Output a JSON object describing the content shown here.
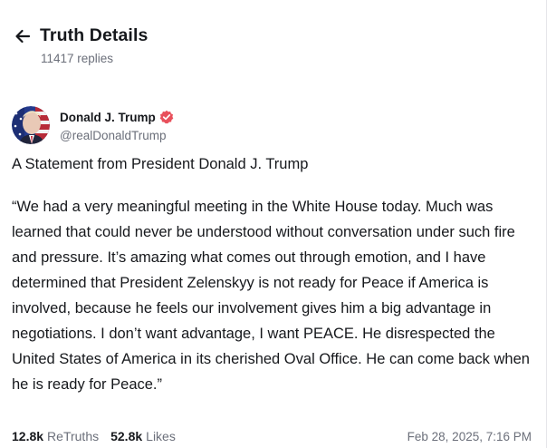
{
  "header": {
    "back_icon": "arrow-left-icon",
    "title": "Truth Details",
    "replies": "11417 replies"
  },
  "post": {
    "author": {
      "name": "Donald J. Trump",
      "handle": "@realDonaldTrump",
      "verified_icon": "verified-badge-icon",
      "verified_color": "#e8505b"
    },
    "heading": "A Statement from President Donald J. Trump",
    "body": "“We had a very meaningful meeting in the White House today. Much was learned that could never be understood without conversation under such fire and pressure. It’s amazing what comes out through emotion, and I have determined that President Zelenskyy is not ready for Peace if America is involved, because he feels our involvement gives him a big advantage in negotiations. I don’t want advantage, I want PEACE. He disrespected the United States of America in its cherished Oval Office. He can come back when he is ready for Peace.”",
    "stats": {
      "retruths_count": "12.8k",
      "retruths_label": "ReTruths",
      "likes_count": "52.8k",
      "likes_label": "Likes"
    },
    "timestamp": "Feb 28, 2025, 7:16 PM"
  },
  "colors": {
    "text_primary": "#16181c",
    "text_secondary": "#6b6f7a",
    "accent": "#e8505b"
  }
}
